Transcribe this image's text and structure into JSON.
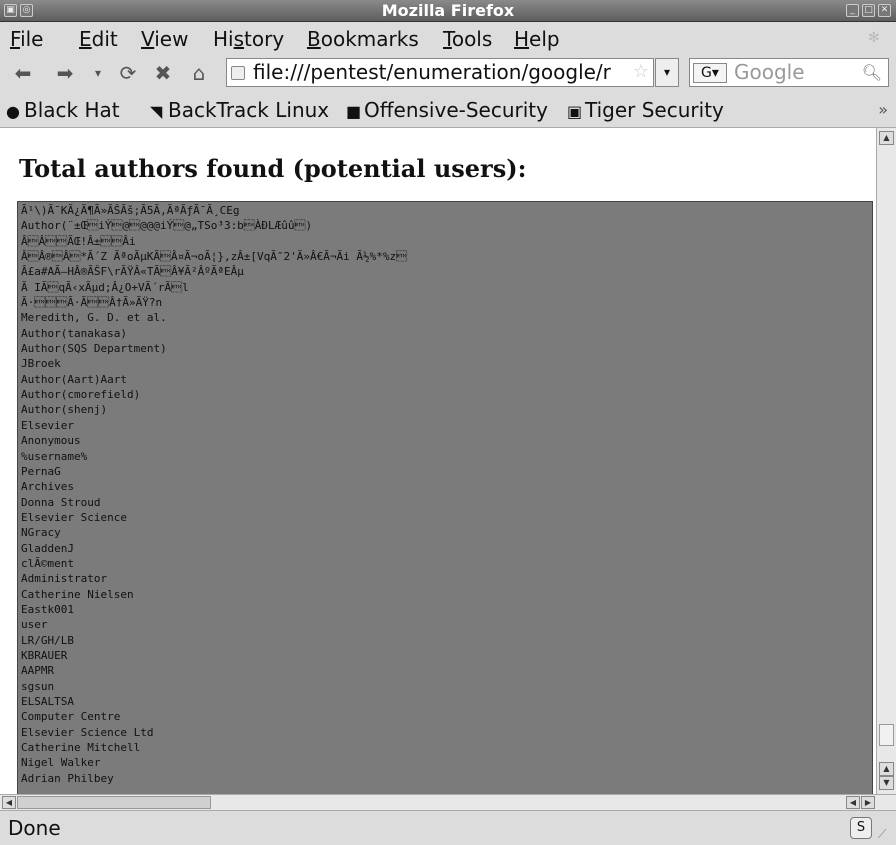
{
  "window": {
    "title": "Mozilla Firefox"
  },
  "menu": {
    "items": [
      {
        "label": "File",
        "mnemonic": "F",
        "rest": "ile"
      },
      {
        "label": "Edit",
        "mnemonic": "E",
        "rest": "dit"
      },
      {
        "label": "View",
        "mnemonic": "V",
        "rest": "iew"
      },
      {
        "label": "History",
        "mnemonic": "s",
        "pre": "Hi",
        "rest": "tory"
      },
      {
        "label": "Bookmarks",
        "mnemonic": "B",
        "rest": "ookmarks"
      },
      {
        "label": "Tools",
        "mnemonic": "T",
        "rest": "ools"
      },
      {
        "label": "Help",
        "mnemonic": "H",
        "rest": "elp"
      }
    ]
  },
  "nav": {
    "url": "file:///pentest/enumeration/google/r",
    "search_placeholder": "Google",
    "search_engine": "G"
  },
  "bookmarks": [
    {
      "label": "Black Hat",
      "icon": "globe-icon"
    },
    {
      "label": "BackTrack Linux",
      "icon": "terminal-icon"
    },
    {
      "label": "Offensive-Security",
      "icon": "offsec-icon"
    },
    {
      "label": "Tiger Security",
      "icon": "page-icon"
    }
  ],
  "page": {
    "heading": "Total authors found (potential users):",
    "authors": [
      "Ã¹\\)Ã¯KÃ¿Ã¶Ã»ÃŠÃš;Ã5Ã,ÃªÃƒÃ¯Ã¸CEg",
      "Author(¨±Œ\u0003iÝ\u0003@\u0003@@@iÝ\u0003@„TSo³3:b\u0003ÀÐLÆûû\u0003)",
      "Â\u0003Â\u0003\u0003ÃŒ!Â±\u0003\u0003Âi",
      "Â\u0003Â®\u0003Â\u0003*Ã´Z ÃªoÃµKÃ\u0003Â¤Ã¬oÃ¦},zÂ±[VqÃ″2'Ã»Â€Ã¬Ãi Ã½%*%z\u0003",
      "Â£a#AÃ—HÂ®ÃŠF\\rÃŸÂ«TÃ\u0003Â¥Ã²ÂºÃªEÂµ",
      "Ã IÃ\u0003qÃ‹xÃµd;Â¿O+VÃ´rÃ\u0003l",
      "Ã·\u0003\u0003\u0003Ã·Ã\u0003\u0003Â†Ã»ÃŸ?n",
      "Meredith, G. D. et al.",
      "Author(tanakasa)",
      "Author(SQS Department)",
      "JBroek",
      "Author(Aart)Aart",
      "Author(cmorefield)",
      "Author(shenj)",
      "Elsevier",
      "Anonymous",
      "%username%",
      "PernaG",
      "Archives",
      "Donna Stroud",
      "Elsevier Science",
      "NGracy",
      "GladdenJ",
      "clÃ©ment",
      "Administrator",
      "Catherine Nielsen",
      "Eastk001",
      "user",
      "LR/GH/LB",
      "KBRAUER",
      "AAPMR",
      "sgsun",
      "ELSALTSA",
      "Computer Centre",
      "Elsevier Science Ltd",
      "Catherine Mitchell",
      "Nigel Walker",
      "Adrian Philbey"
    ]
  },
  "status": {
    "text": "Done"
  }
}
